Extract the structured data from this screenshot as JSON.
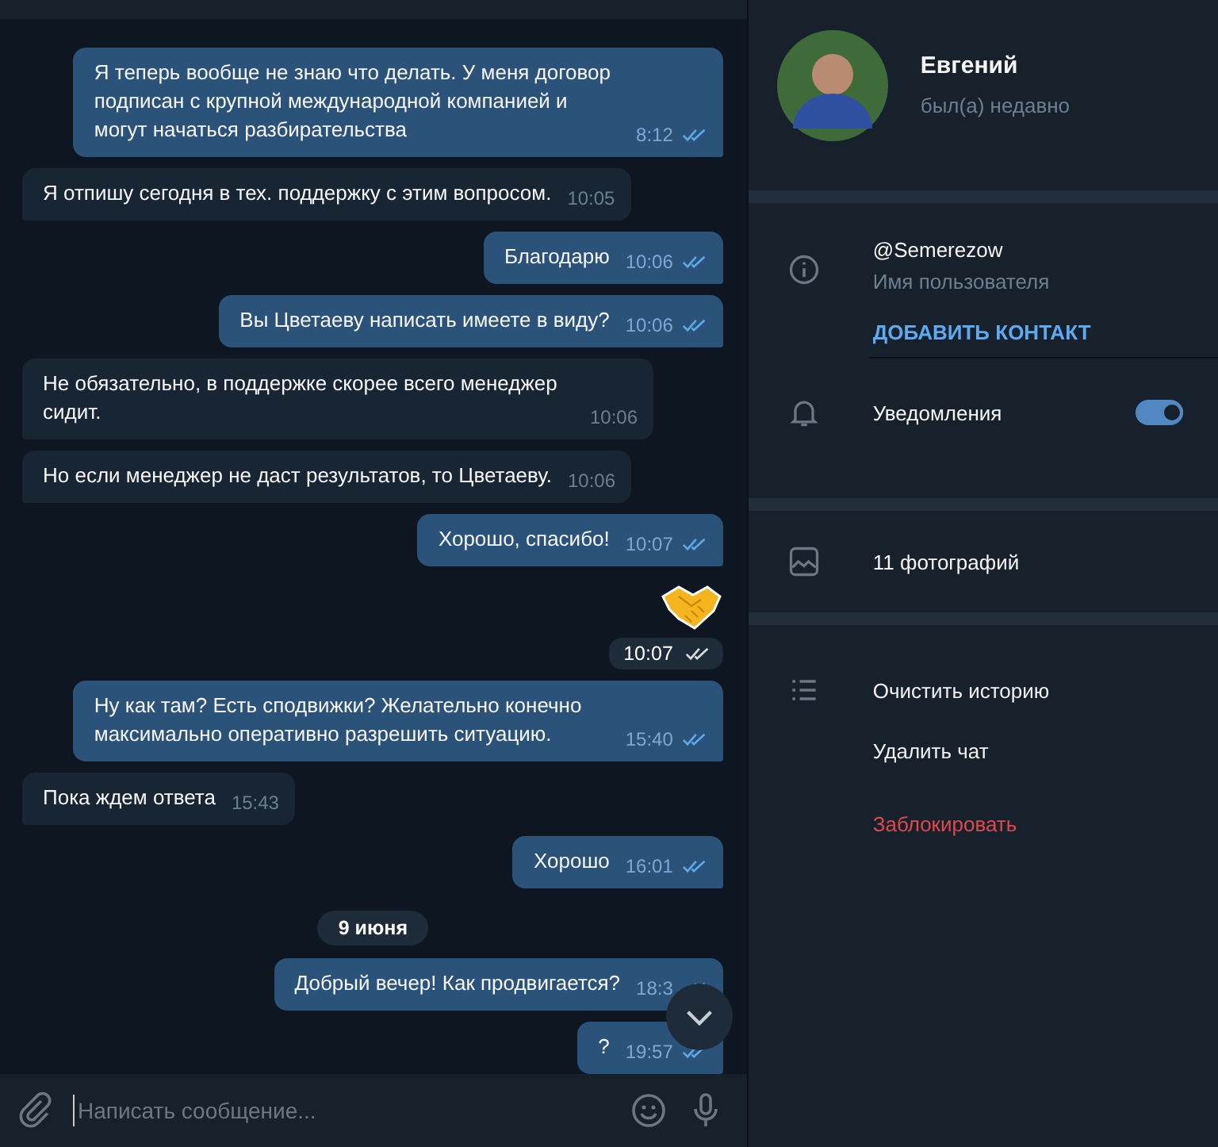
{
  "chat": {
    "messages": [
      {
        "kind": "text",
        "outgoing": true,
        "text": "Я теперь вообще не знаю что делать. У меня договор подписан с крупной международной компанией и могут начаться разбирательства",
        "time": "8:12"
      },
      {
        "kind": "text",
        "outgoing": false,
        "text": "Я отпишу сегодня в тех. поддержку с этим вопросом.",
        "time": "10:05"
      },
      {
        "kind": "text",
        "outgoing": true,
        "text": "Благодарю",
        "time": "10:06"
      },
      {
        "kind": "text",
        "outgoing": true,
        "text": "Вы Цветаеву написать имеете в виду?",
        "time": "10:06"
      },
      {
        "kind": "text",
        "outgoing": false,
        "text": "Не обязательно, в поддержке скорее всего менеджер сидит.",
        "time": "10:06"
      },
      {
        "kind": "text",
        "outgoing": false,
        "text": "Но если менеджер не даст результатов, то Цветаеву.",
        "time": "10:06"
      },
      {
        "kind": "text",
        "outgoing": true,
        "text": "Хорошо, спасибо!",
        "time": "10:07"
      },
      {
        "kind": "sticker",
        "outgoing": true,
        "time": "10:07"
      },
      {
        "kind": "text",
        "outgoing": true,
        "text": "Ну как там? Есть сподвижки? Желательно конечно максимально оперативно разрешить ситуацию.",
        "time": "15:40"
      },
      {
        "kind": "text",
        "outgoing": false,
        "text": "Пока ждем ответа",
        "time": "15:43"
      },
      {
        "kind": "text",
        "outgoing": true,
        "text": "Хорошо",
        "time": "16:01"
      },
      {
        "kind": "date",
        "text": "9 июня"
      },
      {
        "kind": "text",
        "outgoing": true,
        "text": "Добрый вечер! Как продвигается?",
        "time": "18:3"
      },
      {
        "kind": "text",
        "outgoing": true,
        "text": "?",
        "time": "19:57"
      }
    ]
  },
  "composer": {
    "placeholder": "Написать сообщение..."
  },
  "profile": {
    "name": "Евгений",
    "status": "был(а) недавно",
    "username": "@Semerezow",
    "username_label": "Имя пользователя",
    "add_contact": "ДОБАВИТЬ КОНТАКТ",
    "notifications": {
      "label": "Уведомления",
      "on": true
    },
    "photos": "11 фотографий",
    "actions": [
      {
        "label": "Очистить историю",
        "kind": "normal"
      },
      {
        "label": "Удалить чат",
        "kind": "normal"
      },
      {
        "label": "Заблокировать",
        "kind": "danger"
      }
    ]
  }
}
